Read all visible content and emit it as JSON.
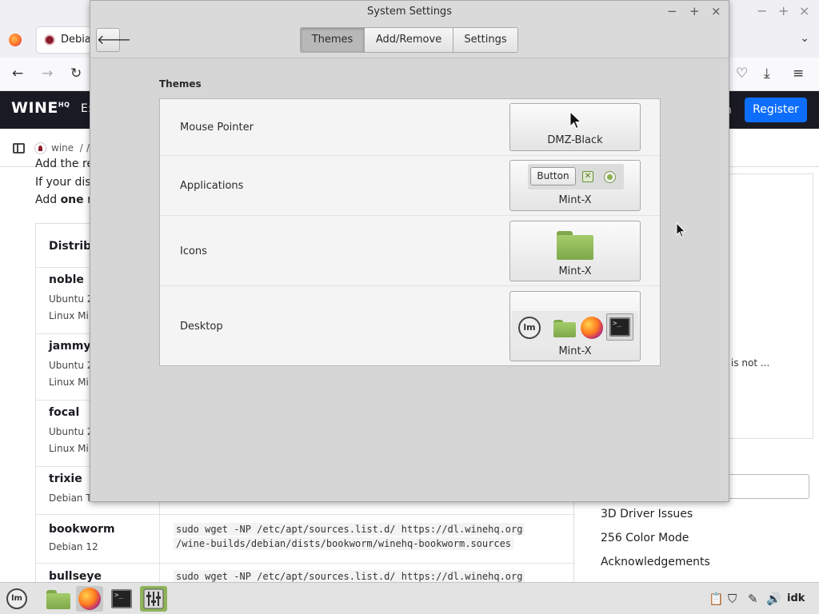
{
  "browser": {
    "tab_title": "Debia",
    "winctl": {
      "minimize": "−",
      "maximize": "+",
      "close": "×"
    },
    "tabs_menu": "⌄",
    "nav": {
      "back": "←",
      "forward": "→",
      "reload": "↻"
    },
    "toolbar_right": {
      "pocket": "♡",
      "downloads": "⤓",
      "menu": "≡"
    },
    "header": {
      "logo": "WINE",
      "logo_sup": "HQ",
      "nav_partial": "E:",
      "nav_right_partial": "n",
      "register": "Register"
    },
    "breadcrumb": {
      "site": "wine",
      "sep": "/",
      "trailing": "/"
    },
    "content": {
      "para1": "Add the re",
      "para2": "If your dist",
      "para3_prefix": "Add ",
      "para3_bold": "one",
      "para3_suffix": " re",
      "table_header": "Distribu",
      "rows": [
        {
          "name": "noble",
          "sub1": "Ubuntu 2",
          "sub2": "Linux Mi"
        },
        {
          "name": "jammy",
          "sub1": "Ubuntu 2",
          "sub2": "Linux Mi"
        },
        {
          "name": "focal",
          "sub1": "Ubuntu 2",
          "sub2": "Linux Mi"
        },
        {
          "name": "trixie",
          "sub1": "Debian T",
          "sub2": ""
        },
        {
          "name": "bookworm",
          "sub1": "Debian 12",
          "sub2": "",
          "code1": "sudo wget -NP /etc/apt/sources.list.d/ https://dl.winehq.org",
          "code2": "/wine-builds/debian/dists/bookworm/winehq-bookworm.sources"
        },
        {
          "name": "bullseye",
          "sub1": "",
          "sub2": "",
          "code1": "sudo wget -NP /etc/apt/sources.list.d/ https://dl.winehq.org",
          "code2": ""
        }
      ],
      "side_truncated": "is not ...",
      "side_links": [
        "3D Driver Issues",
        "256 Color Mode",
        "Acknowledgements"
      ]
    }
  },
  "dialog": {
    "title": "System Settings",
    "controls": {
      "minimize": "−",
      "maximize": "+",
      "close": "×"
    },
    "back": "🡐",
    "tabs": [
      {
        "label": "Themes",
        "active": true
      },
      {
        "label": "Add/Remove",
        "active": false
      },
      {
        "label": "Settings",
        "active": false
      }
    ],
    "section_title": "Themes",
    "rows": [
      {
        "label": "Mouse Pointer",
        "value": "DMZ-Black",
        "preview": "cursor-icon"
      },
      {
        "label": "Applications",
        "value": "Mint-X",
        "preview": "widget-preview",
        "preview_button": "Button",
        "check_glyph": "✕"
      },
      {
        "label": "Icons",
        "value": "Mint-X",
        "preview": "folder-icon"
      },
      {
        "label": "Desktop",
        "value": "Mint-X",
        "preview": "desktop-preview",
        "mint_glyph": "lm",
        "term_glyph": ">_"
      }
    ]
  },
  "taskbar": {
    "menu_glyph": "lm",
    "term_glyph": ">_",
    "tray": {
      "clipboard": "📋",
      "shield": "⛉",
      "network": "✎",
      "volume": "🔊",
      "user": "idk"
    }
  }
}
